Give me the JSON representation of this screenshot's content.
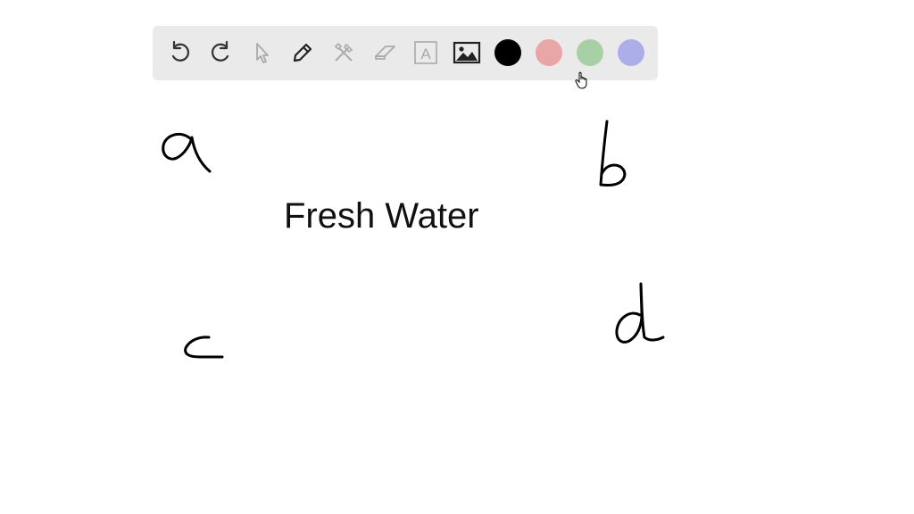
{
  "toolbar": {
    "tools": [
      "undo",
      "redo",
      "select",
      "pen",
      "tools",
      "eraser",
      "text",
      "image"
    ],
    "colors": [
      {
        "name": "black",
        "hex": "#000000",
        "selected": true
      },
      {
        "name": "red",
        "hex": "#e8a6a6",
        "selected": false
      },
      {
        "name": "green",
        "hex": "#a8cfa6",
        "selected": false
      },
      {
        "name": "blue",
        "hex": "#abaee8",
        "selected": false
      }
    ],
    "text_tool_glyph": "A"
  },
  "board": {
    "typed_text": "Fresh Water",
    "handwritten_labels": [
      "a",
      "b",
      "c",
      "d"
    ]
  }
}
